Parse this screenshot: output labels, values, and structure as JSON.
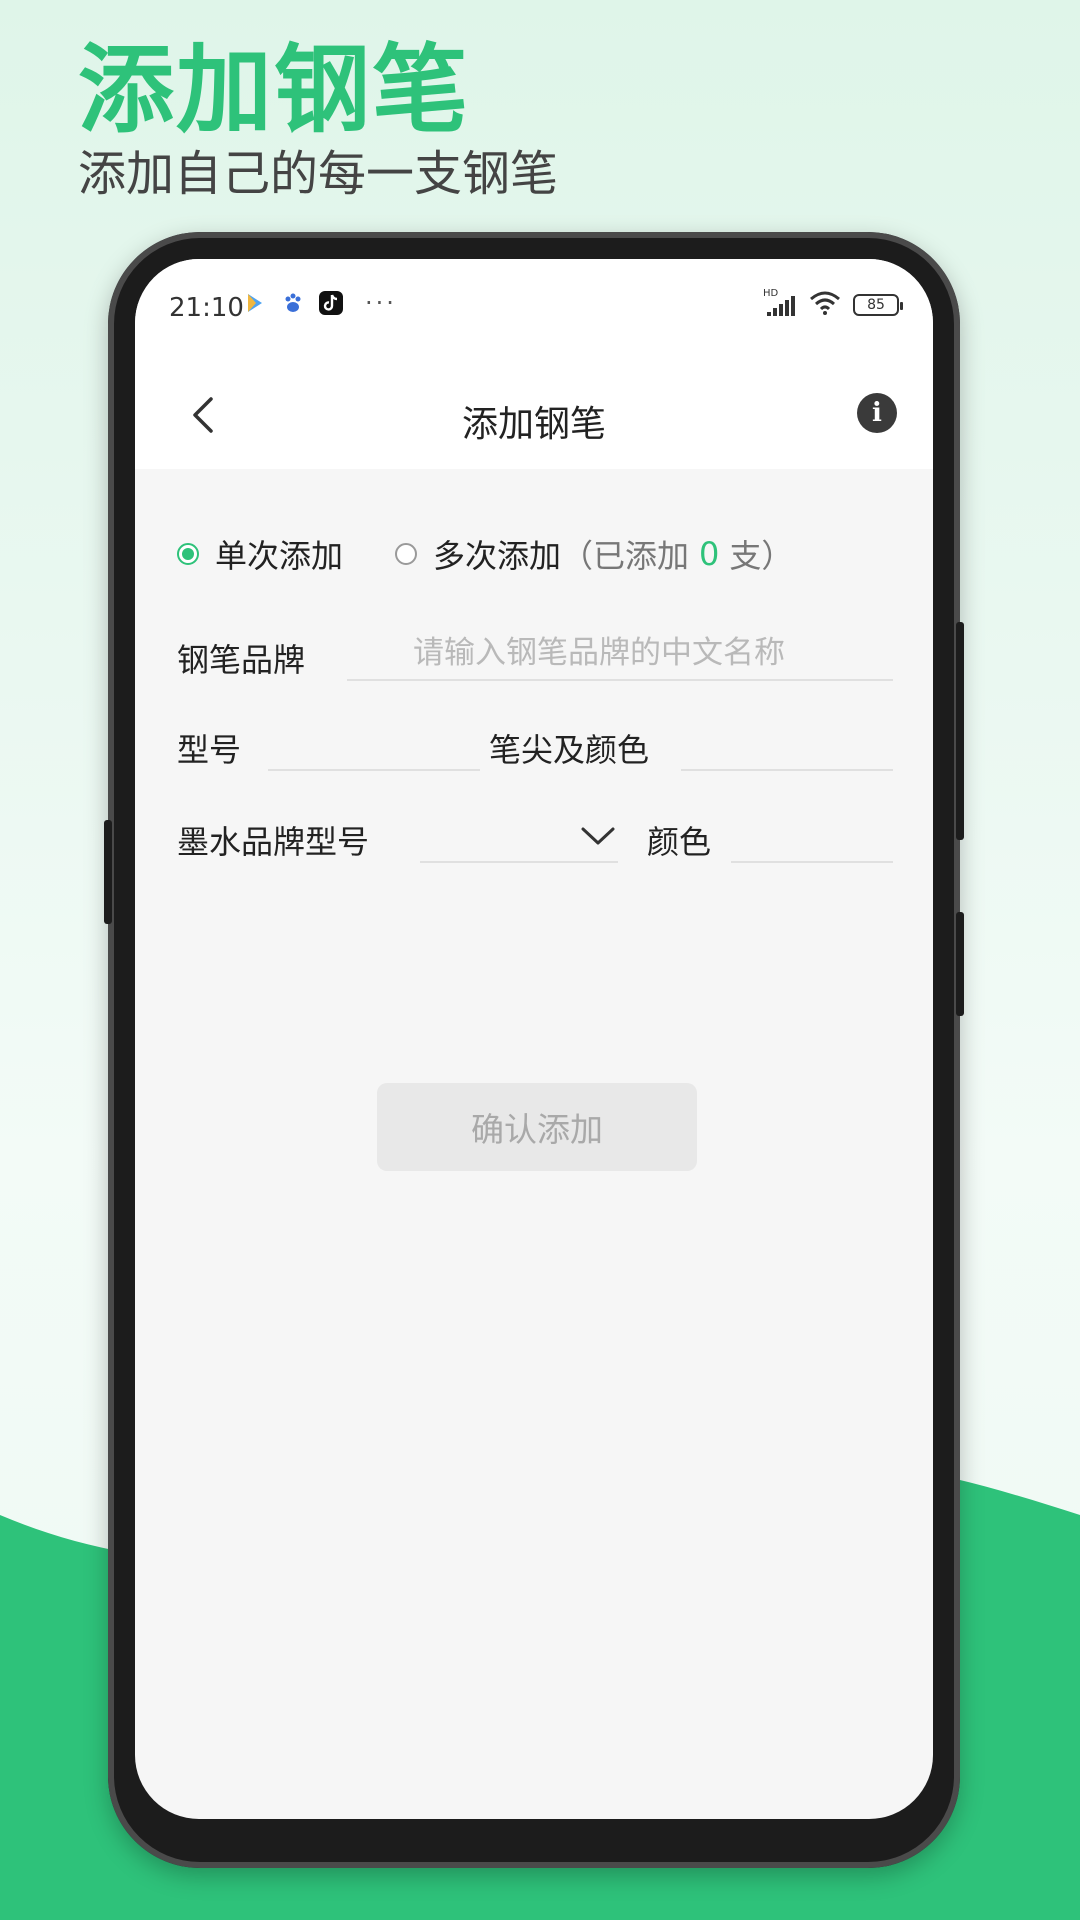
{
  "promo": {
    "title": "添加钢笔",
    "subtitle": "添加自己的每一支钢笔"
  },
  "status_bar": {
    "time": "21:10",
    "more": "···",
    "battery": "85",
    "network": "HD"
  },
  "nav": {
    "title": "添加钢笔",
    "info_icon": "i"
  },
  "mode": {
    "single_label": "单次添加",
    "multi_label": "多次添加",
    "paren_open": "（已添加",
    "count": "0",
    "paren_close": "支）",
    "selected": "single"
  },
  "form": {
    "brand_label": "钢笔品牌",
    "brand_placeholder": "请输入钢笔品牌的中文名称",
    "model_label": "型号",
    "nib_label": "笔尖及颜色",
    "ink_label": "墨水品牌型号",
    "color_label": "颜色"
  },
  "confirm_button": "确认添加",
  "colors": {
    "accent": "#2ec27a",
    "button_bg": "#e8e8e8",
    "button_text": "#a9a9a9"
  }
}
